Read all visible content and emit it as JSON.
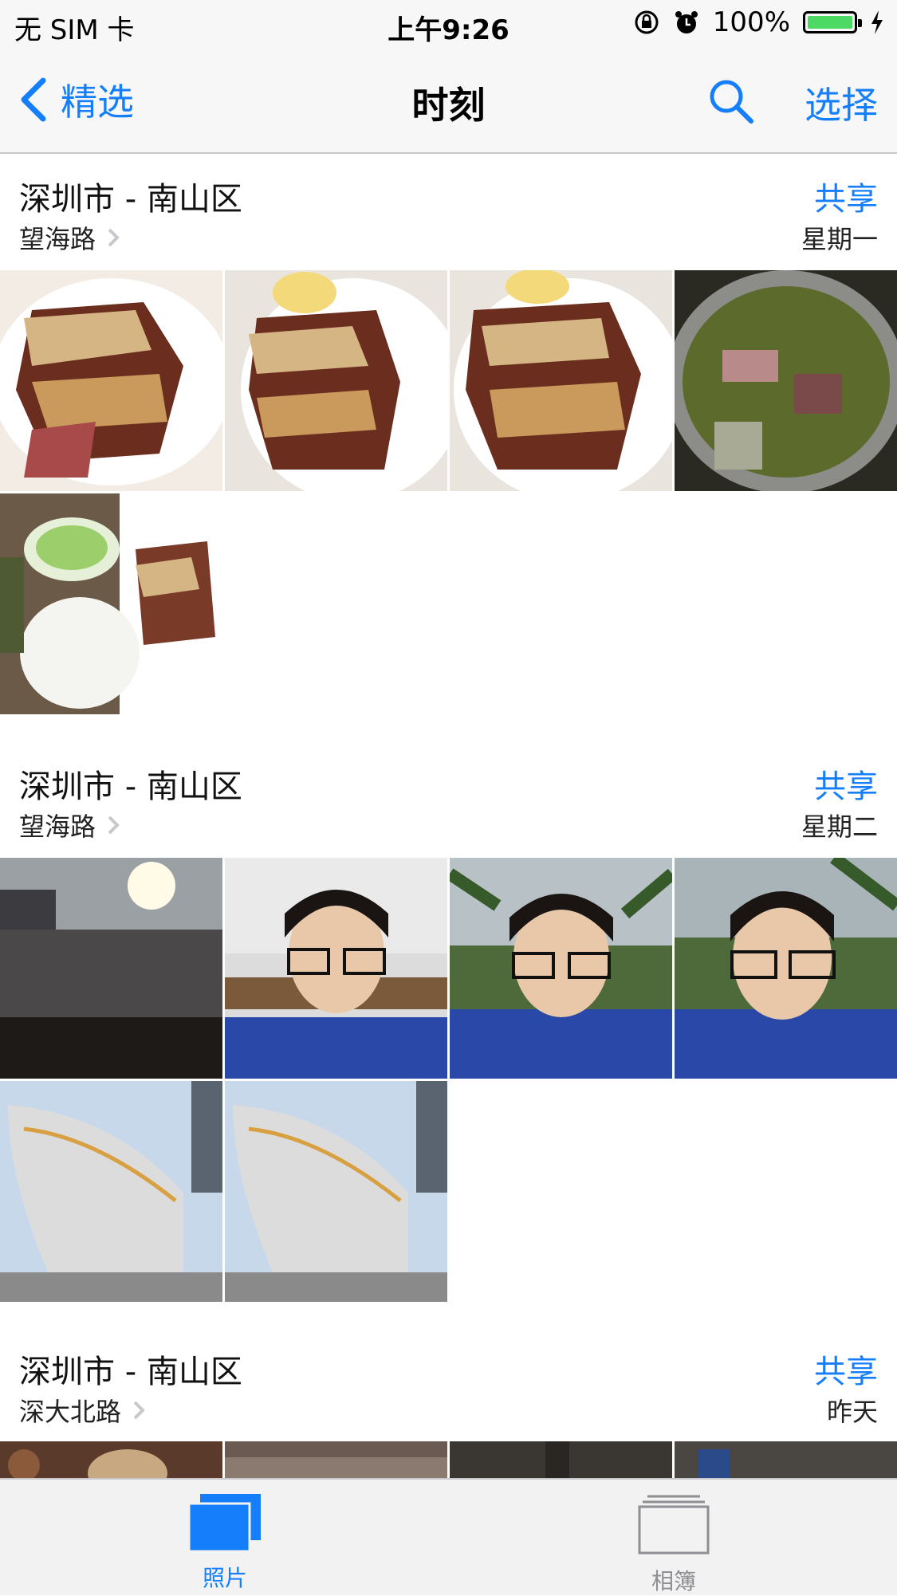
{
  "status": {
    "carrier": "无 SIM 卡",
    "time": "上午9:26",
    "battery": "100%",
    "icons": [
      "rotation-lock-icon",
      "alarm-icon",
      "battery-icon",
      "charging-bolt-icon"
    ]
  },
  "nav": {
    "back_label": "精选",
    "title": "时刻",
    "select_label": "选择",
    "accent_color": "#147efb"
  },
  "sections": [
    {
      "title": "深圳市 - 南山区",
      "subtitle": "望海路",
      "share": "共享",
      "day": "星期一",
      "photos": [
        "food-plate-roast",
        "food-plate-roast-egg",
        "food-plate-roast-egg",
        "soup-pot",
        "meal-tray-rice"
      ]
    },
    {
      "title": "深圳市 - 南山区",
      "subtitle": "望海路",
      "share": "共享",
      "day": "星期二",
      "photos": [
        "ship-sunset",
        "selfie-ship",
        "selfie-palms",
        "selfie-palms",
        "ship-hull",
        "ship-hull"
      ]
    },
    {
      "title": "深圳市 - 南山区",
      "subtitle": "深大北路",
      "share": "共享",
      "day": "昨天",
      "photos": [
        "plush-toy",
        "street",
        "street-dark",
        "street-dark"
      ]
    }
  ],
  "tabbar": {
    "photos_label": "照片",
    "albums_label": "相簿"
  }
}
